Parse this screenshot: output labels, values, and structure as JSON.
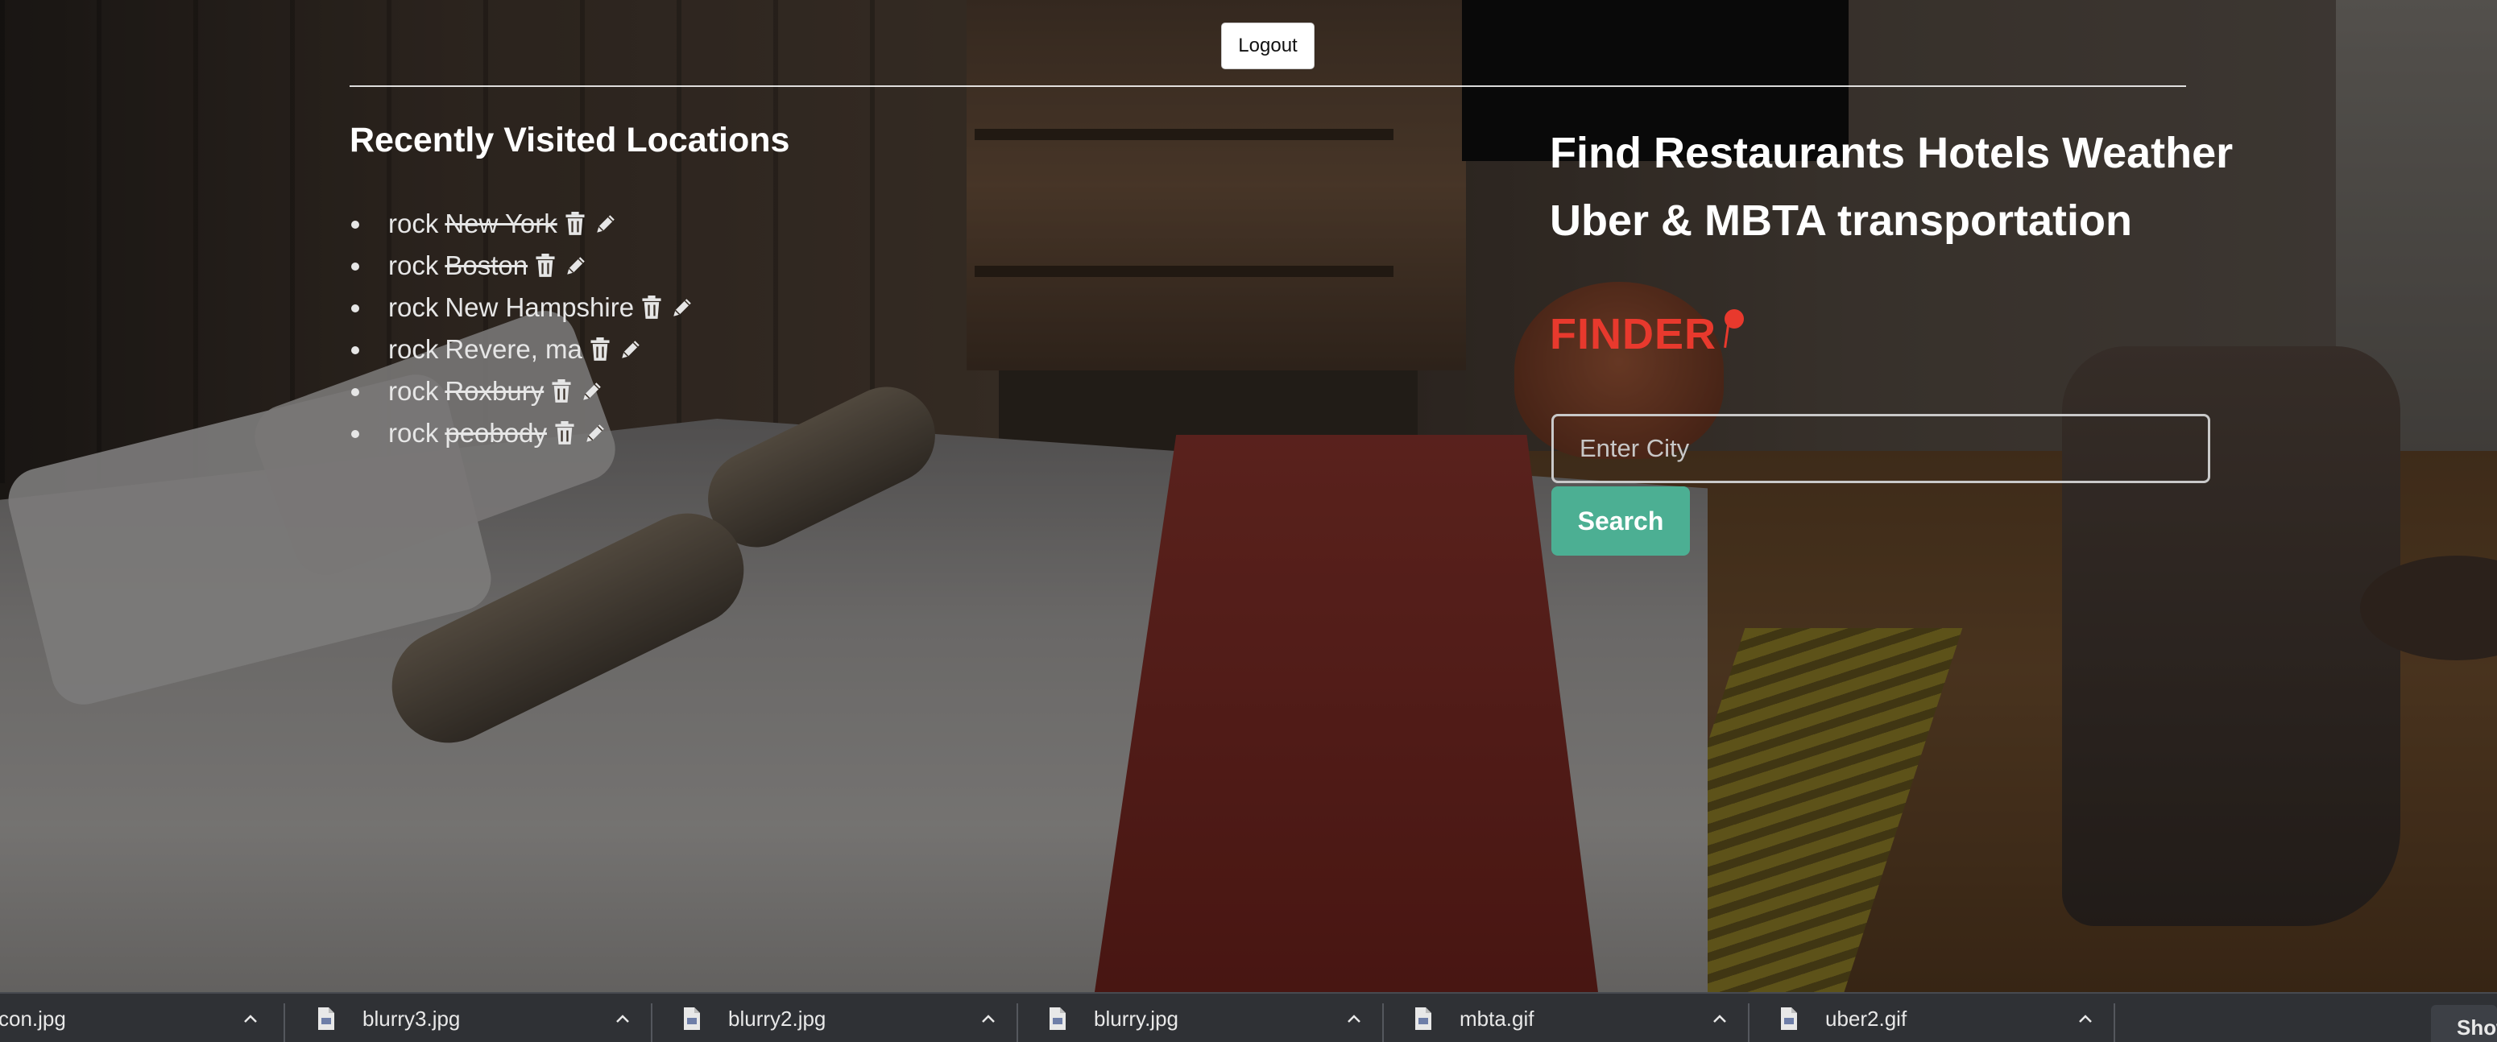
{
  "header": {
    "logout_label": "Logout"
  },
  "recent": {
    "title": "Recently Visited Locations",
    "items": [
      {
        "prefix": "rock",
        "location": "New York",
        "struck": true
      },
      {
        "prefix": "rock",
        "location": "Boston",
        "struck": true
      },
      {
        "prefix": "rock",
        "location": "New Hampshire",
        "struck": false
      },
      {
        "prefix": "rock",
        "location": "Revere, ma",
        "struck": false
      },
      {
        "prefix": "rock",
        "location": "Roxbury",
        "struck": true
      },
      {
        "prefix": "rock",
        "location": "peobody",
        "struck": true
      }
    ],
    "icons": [
      "trash-icon",
      "pencil-icon"
    ]
  },
  "hero": {
    "headline": "Find Restaurants Hotels Weather Uber & MBTA transportation",
    "logo_text": "FINDER",
    "logo_icon": "map-pin-icon",
    "brand_color": "#e8392d"
  },
  "search": {
    "placeholder": "Enter City",
    "value": "",
    "button_label": "Search",
    "button_color": "#4caf93"
  },
  "downloads": {
    "items": [
      {
        "name": "con.jpg"
      },
      {
        "name": "blurry3.jpg"
      },
      {
        "name": "blurry2.jpg"
      },
      {
        "name": "blurry.jpg"
      },
      {
        "name": "mbta.gif"
      },
      {
        "name": "uber2.gif"
      }
    ],
    "show_all_label": "Show all"
  }
}
